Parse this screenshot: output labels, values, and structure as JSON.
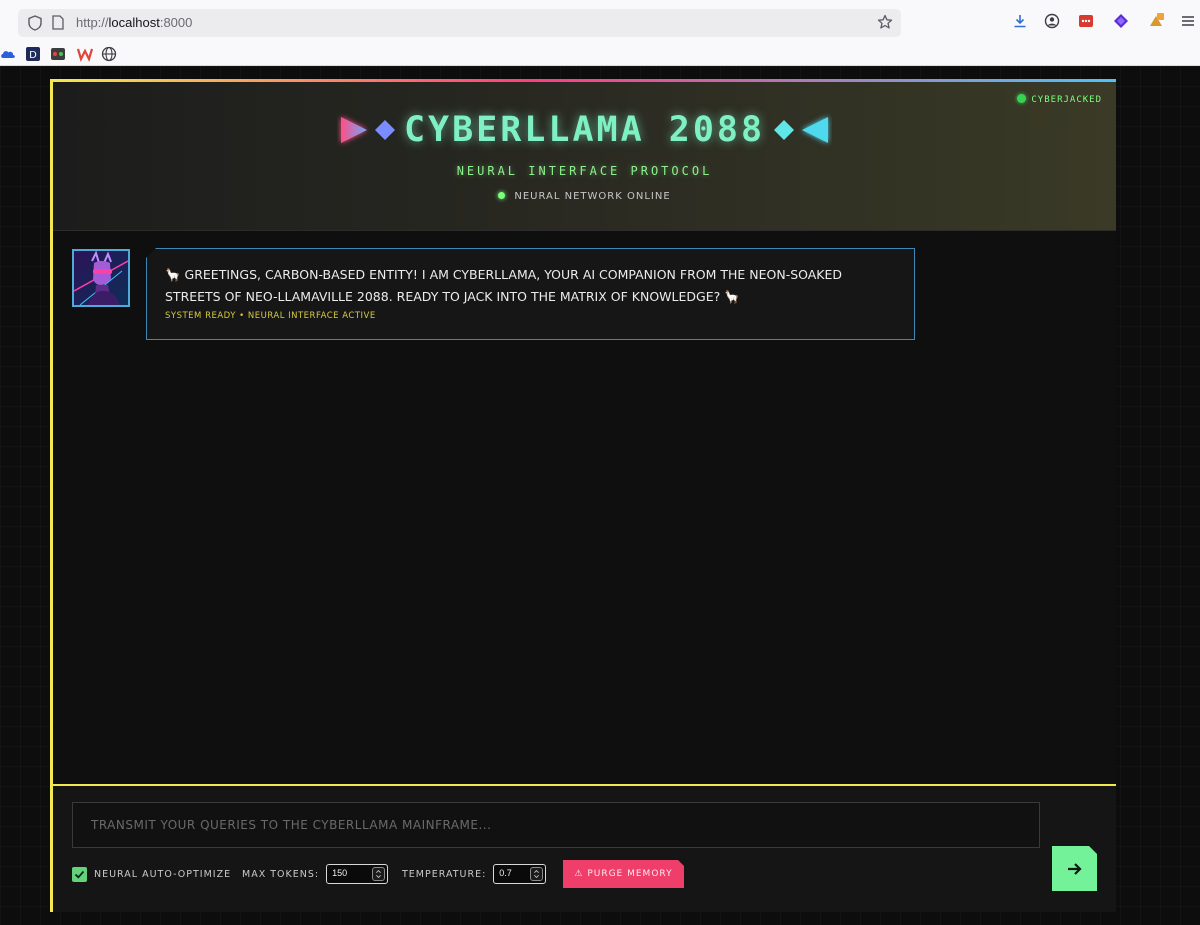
{
  "browser": {
    "url_prefix": "http://",
    "url_host": "localhost",
    "url_suffix": ":8000"
  },
  "header": {
    "status_badge": "CYBERJACKED",
    "title": "CYBERLLAMA 2088",
    "subtitle": "NEURAL INTERFACE PROTOCOL",
    "online_status": "NEURAL NETWORK ONLINE"
  },
  "chat": {
    "messages": [
      {
        "text": "🦙 GREETINGS, CARBON-BASED ENTITY! I AM CYBERLLAMA, YOUR AI COMPANION FROM THE NEON-SOAKED STREETS OF NEO-LLAMAVILLE 2088. READY TO JACK INTO THE MATRIX OF KNOWLEDGE? 🦙",
        "meta": "SYSTEM READY • NEURAL INTERFACE ACTIVE"
      }
    ]
  },
  "input": {
    "placeholder": "TRANSMIT YOUR QUERIES TO THE CYBERLLAMA MAINFRAME...",
    "auto_optimize_label": "NEURAL AUTO-OPTIMIZE",
    "auto_optimize_checked": true,
    "max_tokens_label": "MAX TOKENS:",
    "max_tokens_value": "150",
    "temperature_label": "TEMPERATURE:",
    "temperature_value": "0.7",
    "purge_label": "⚠ PURGE MEMORY"
  },
  "colors": {
    "accent_yellow": "#f2e94e",
    "title_green": "#7ff0c4",
    "neon_pink": "#f03e6b",
    "neon_cyan": "#4fc3f7",
    "send_green": "#74f29a"
  },
  "icons": {
    "toolbar": [
      "shield-icon",
      "page-icon",
      "star-icon",
      "download-icon",
      "account-icon",
      "extension-red-icon",
      "extension-purple-icon",
      "extension-badge-icon",
      "menu-icon"
    ],
    "bookmarks": [
      "cloud-icon",
      "d-app-icon",
      "game-icon",
      "w-logo-icon",
      "globe-icon"
    ],
    "send": "arrow-right-icon"
  }
}
